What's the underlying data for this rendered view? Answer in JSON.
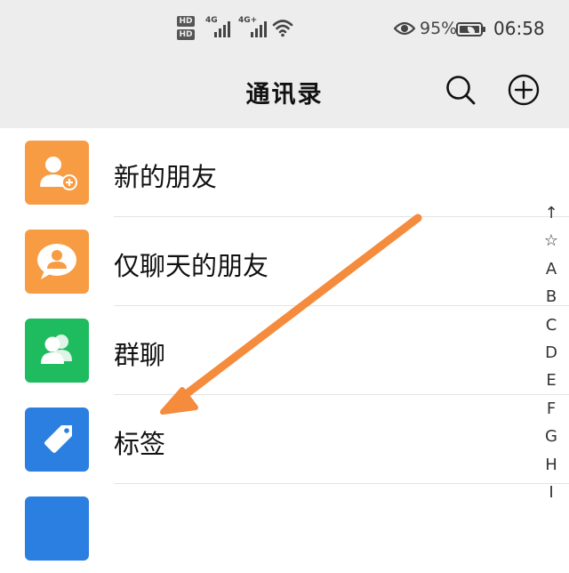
{
  "status_bar": {
    "hd1": "HD",
    "hd2": "HD",
    "sim1_net": "4G",
    "sim2_net": "4G+",
    "battery_percent": "95%",
    "time": "06:58"
  },
  "header": {
    "title": "通讯录"
  },
  "list": {
    "items": [
      {
        "label": "新的朋友",
        "icon": "add-friend-icon",
        "color": "#f79c42"
      },
      {
        "label": "仅聊天的朋友",
        "icon": "chat-only-friend-icon",
        "color": "#f79c42"
      },
      {
        "label": "群聊",
        "icon": "group-chat-icon",
        "color": "#1fbb5f"
      },
      {
        "label": "标签",
        "icon": "tag-icon",
        "color": "#2b7fe0"
      },
      {
        "label": "",
        "icon": "official-account-icon",
        "color": "#2b7fe0"
      }
    ]
  },
  "index_bar": [
    "↑",
    "☆",
    "A",
    "B",
    "C",
    "D",
    "E",
    "F",
    "G",
    "H",
    "I"
  ],
  "annotation": {
    "arrow_color": "#f58b3d"
  },
  "colors": {
    "header_bg": "#ededed",
    "orange": "#f79c42",
    "green": "#1fbb5f",
    "blue": "#2b7fe0"
  }
}
